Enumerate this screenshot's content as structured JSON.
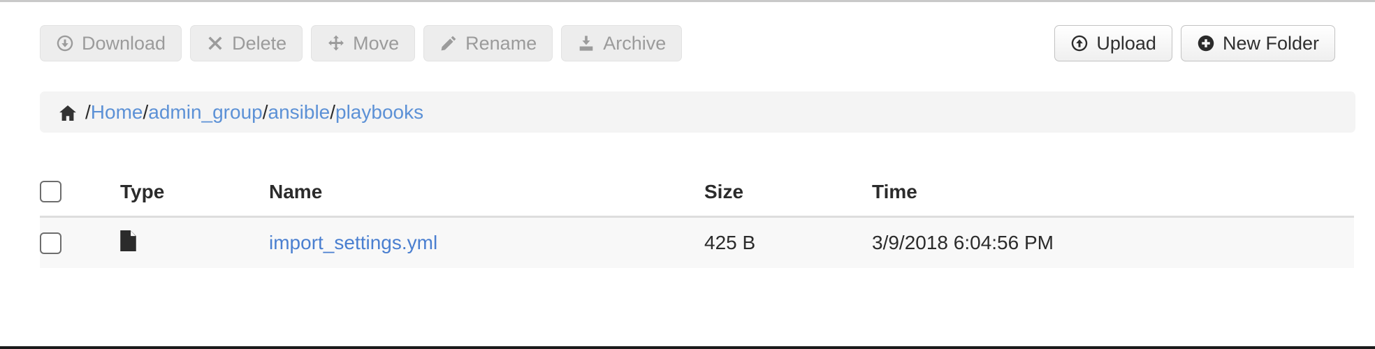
{
  "toolbar": {
    "left_buttons": [
      {
        "label": "Download",
        "icon": "download-circle-icon",
        "enabled": false
      },
      {
        "label": "Delete",
        "icon": "times-icon",
        "enabled": false
      },
      {
        "label": "Move",
        "icon": "arrows-move-icon",
        "enabled": false
      },
      {
        "label": "Rename",
        "icon": "pencil-icon",
        "enabled": false
      },
      {
        "label": "Archive",
        "icon": "archive-tray-icon",
        "enabled": false
      }
    ],
    "right_buttons": [
      {
        "label": "Upload",
        "icon": "upload-circle-icon",
        "enabled": true
      },
      {
        "label": "New Folder",
        "icon": "plus-circle-icon",
        "enabled": true
      }
    ]
  },
  "breadcrumb": {
    "home_icon": "home-icon",
    "separator": "/",
    "segments": [
      {
        "label": "Home"
      },
      {
        "label": "admin_group"
      },
      {
        "label": "ansible"
      },
      {
        "label": "playbooks"
      }
    ]
  },
  "file_table": {
    "columns": [
      "",
      "Type",
      "Name",
      "Size",
      "Time"
    ],
    "select_all_checked": false,
    "rows": [
      {
        "checked": false,
        "type_icon": "file-document-icon",
        "name": "import_settings.yml",
        "size": "425 B",
        "time": "3/9/2018 6:04:56 PM"
      }
    ]
  },
  "colors": {
    "link": "#4a7fd0",
    "breadcrumb_link": "#5c91d6",
    "muted_text": "#9b9b9b",
    "row_background": "#f8f8f8",
    "breadcrumb_background": "#f4f4f4"
  }
}
